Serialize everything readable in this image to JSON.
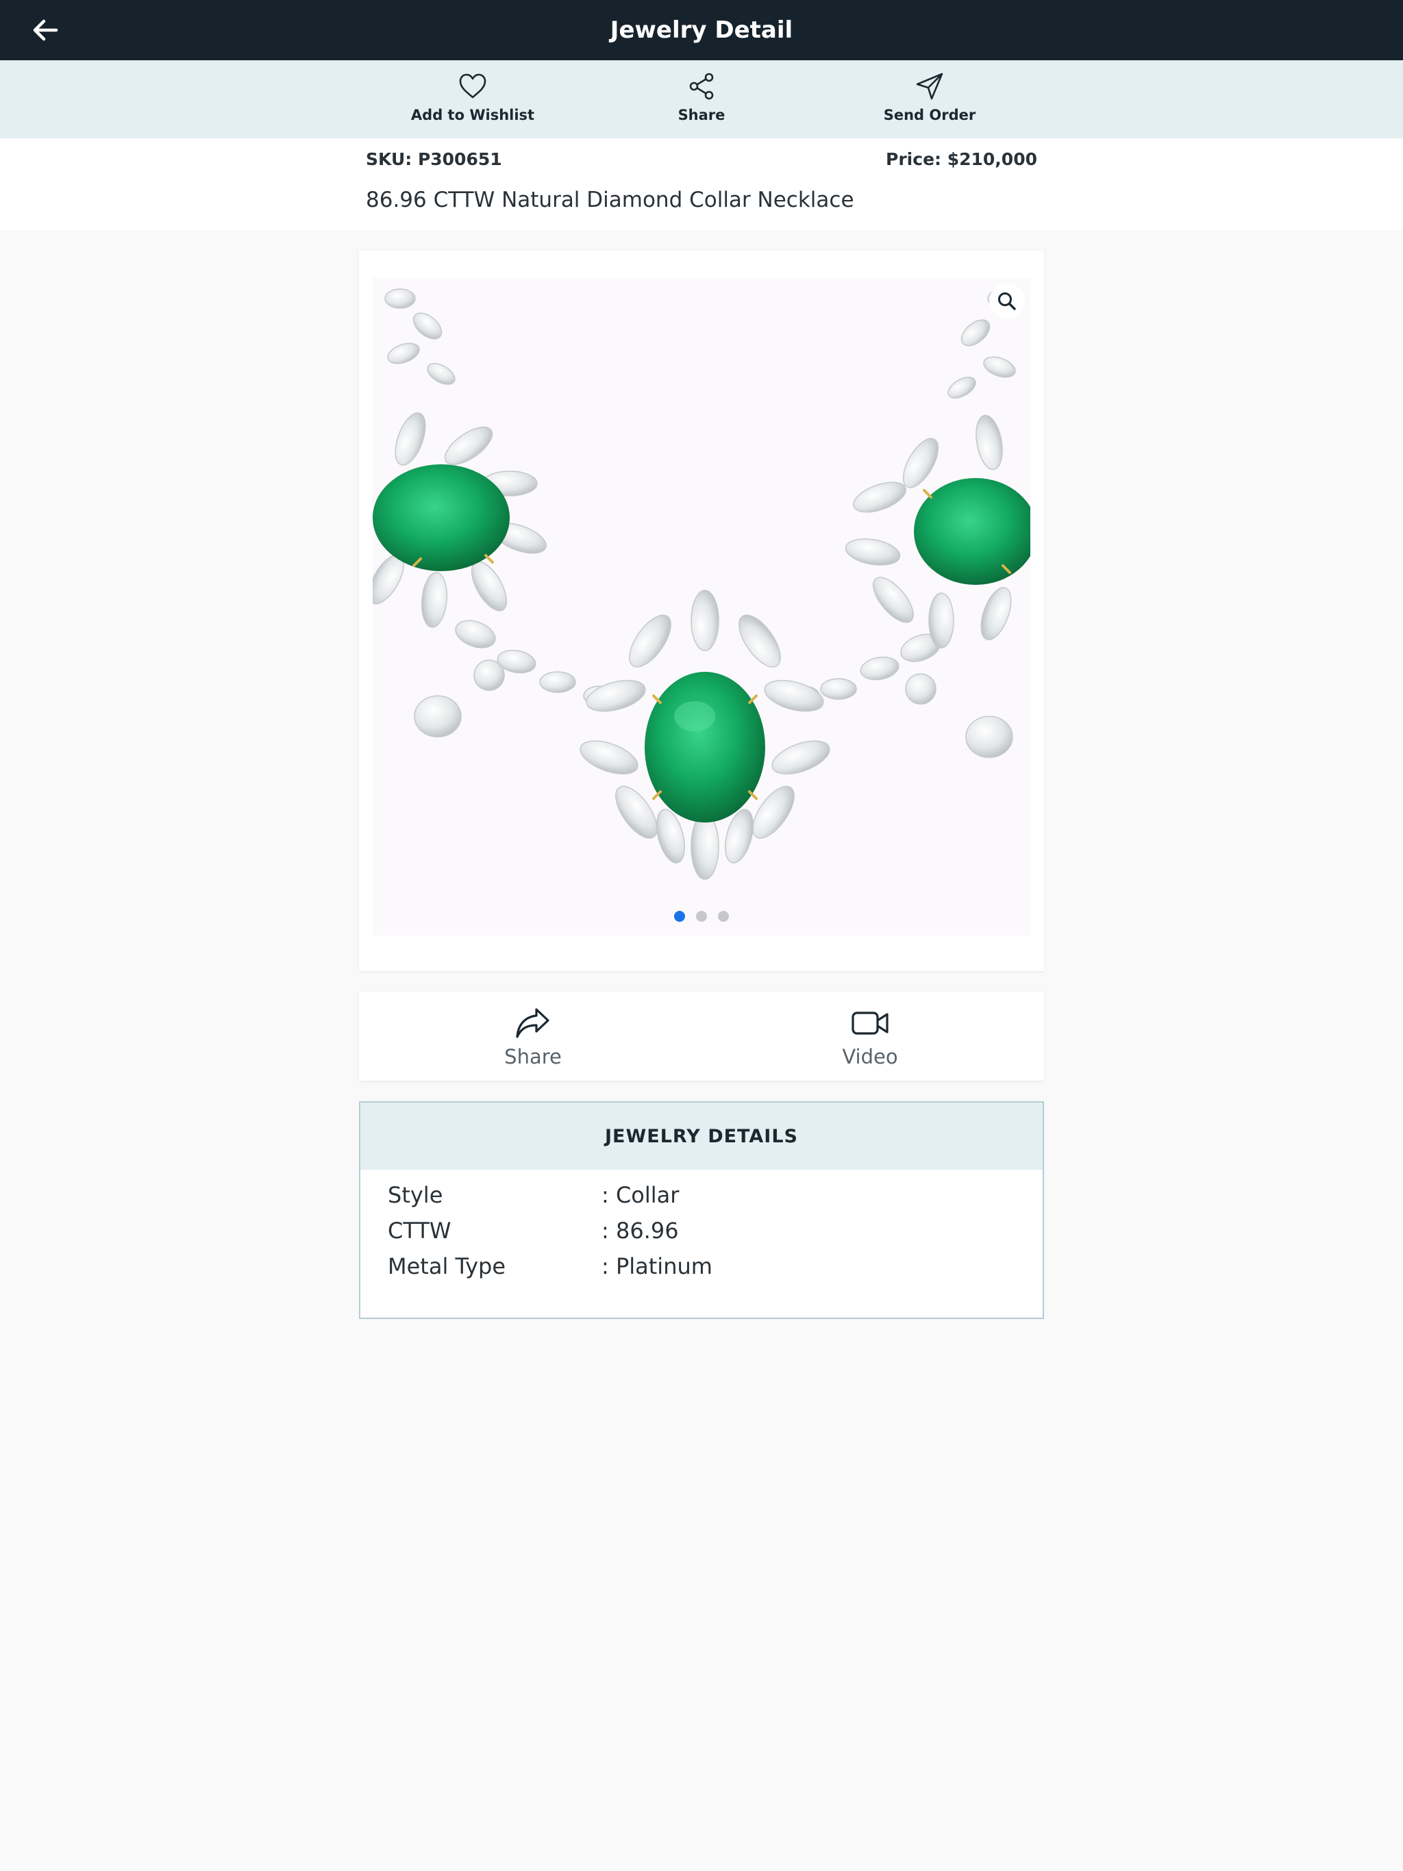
{
  "header": {
    "title": "Jewelry Detail"
  },
  "actions": [
    {
      "label": "Add to Wishlist",
      "icon": "heart-icon"
    },
    {
      "label": "Share",
      "icon": "share-nodes-icon"
    },
    {
      "label": "Send Order",
      "icon": "send-icon"
    }
  ],
  "product": {
    "sku": "SKU: P300651",
    "price": "Price: $210,000",
    "name": "86.96 CTTW Natural Diamond Collar Necklace"
  },
  "gallery": {
    "image_count": 3,
    "active_index": 0,
    "zoom_icon": "magnifier-icon"
  },
  "media": {
    "share_label": "Share",
    "video_label": "Video"
  },
  "details": {
    "title": "JEWELRY DETAILS",
    "rows": [
      {
        "key": "Style",
        "value": ": Collar"
      },
      {
        "key": "CTTW",
        "value": ": 86.96"
      },
      {
        "key": "Metal Type",
        "value": ": Platinum"
      }
    ]
  },
  "colors": {
    "topbar": "#17232c",
    "accent_bar": "#e4eff1",
    "active_dot": "#1a73e8",
    "emerald": "#12a860"
  }
}
